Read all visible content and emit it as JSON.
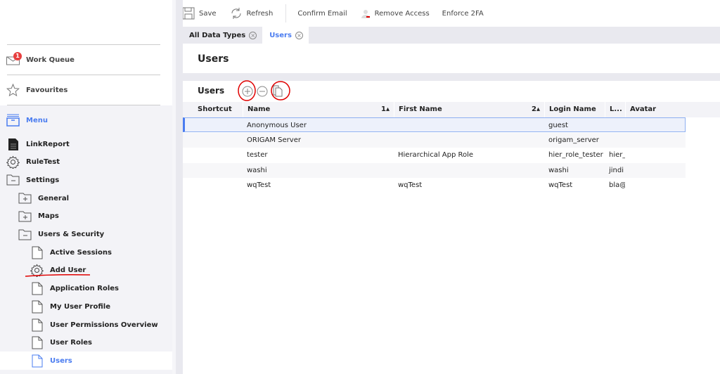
{
  "toolbar": {
    "save": "Save",
    "refresh": "Refresh",
    "confirm_email": "Confirm Email",
    "remove_access": "Remove Access",
    "enforce_2fa": "Enforce 2FA"
  },
  "tabs": [
    {
      "label": "All Data Types"
    },
    {
      "label": "Users"
    }
  ],
  "sidebar": {
    "work_queue": "Work Queue",
    "work_queue_badge": "1",
    "favourites": "Favourites",
    "menu": "Menu",
    "items": [
      {
        "label": "LinkReport"
      },
      {
        "label": "RuleTest"
      },
      {
        "label": "Settings"
      },
      {
        "label": "General"
      },
      {
        "label": "Maps"
      },
      {
        "label": "Users & Security"
      },
      {
        "label": "Active Sessions"
      },
      {
        "label": "Add User"
      },
      {
        "label": "Application Roles"
      },
      {
        "label": "My User Profile"
      },
      {
        "label": "User Permissions Overview"
      },
      {
        "label": "User Roles"
      },
      {
        "label": "Users"
      }
    ]
  },
  "main": {
    "title": "Users",
    "section": "Users",
    "columns": [
      "Shortcut",
      "Name",
      "First Name",
      "Login Name",
      "L...",
      "Avatar"
    ],
    "sort1": "1",
    "sort2": "2",
    "rows": [
      [
        "",
        "Anonymous User",
        "",
        "guest",
        "",
        ""
      ],
      [
        "",
        "ORIGAM Server",
        "",
        "origam_server",
        "",
        ""
      ],
      [
        "",
        "tester",
        "Hierarchical App Role",
        "hier_role_tester",
        "hier_",
        ""
      ],
      [
        "",
        "washi",
        "",
        "washi",
        "jindi",
        ""
      ],
      [
        "",
        "wqTest",
        "wqTest",
        "wqTest",
        "bla@",
        ""
      ]
    ]
  },
  "colors": {
    "accent": "#4a7cf0",
    "annotation": "#e00000"
  }
}
